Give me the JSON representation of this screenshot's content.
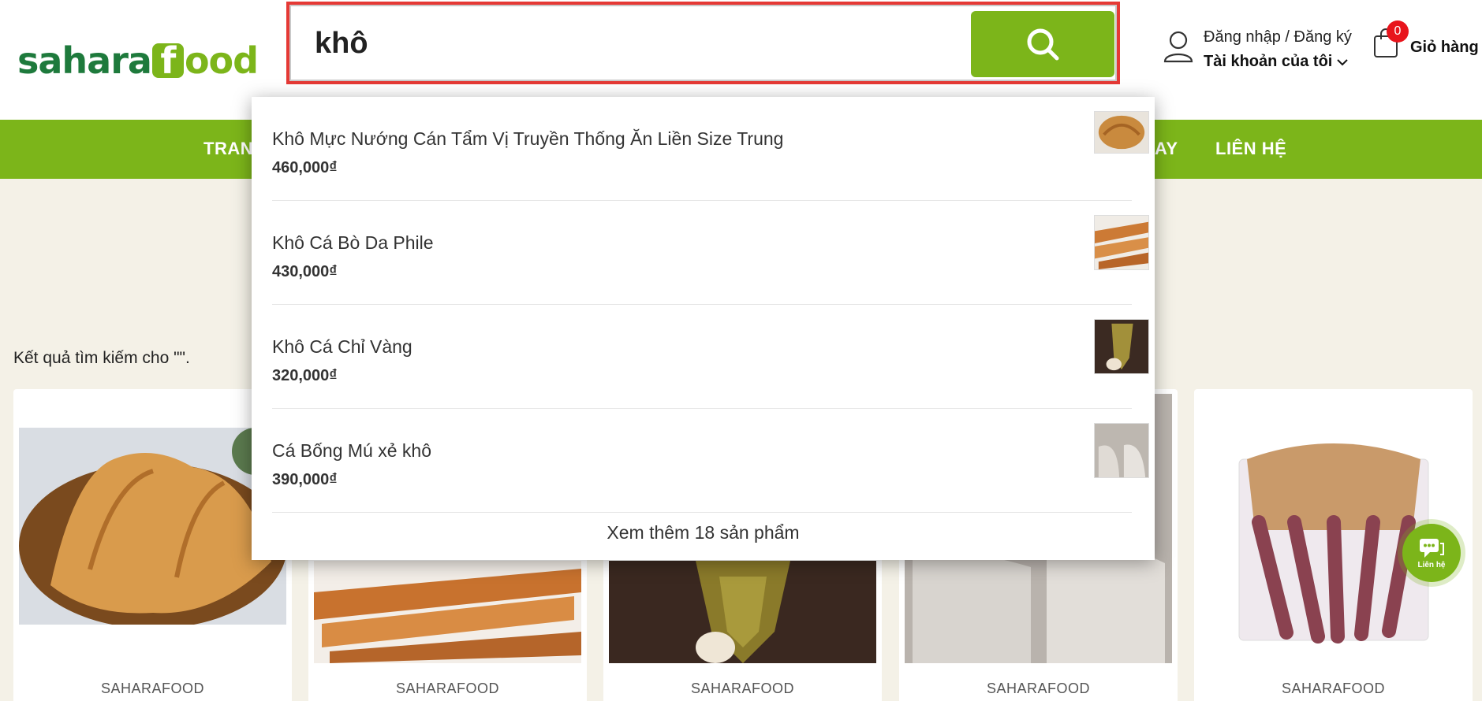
{
  "logo": {
    "part_a": "sahara",
    "part_f": "f",
    "part_b": "ood"
  },
  "search": {
    "value": "khô",
    "placeholder": ""
  },
  "account": {
    "line1": "Đăng nhập / Đăng ký",
    "line2": "Tài khoản của tôi"
  },
  "cart": {
    "count": "0",
    "label": "Giỏ hàng"
  },
  "nav": {
    "items": [
      "TRAN",
      "AY",
      "LIÊN HỆ"
    ]
  },
  "results": {
    "text": "Kết quả tìm kiếm cho \"\"."
  },
  "cards": [
    {
      "brand": "SAHARAFOOD"
    },
    {
      "brand": "SAHARAFOOD"
    },
    {
      "brand": "SAHARAFOOD"
    },
    {
      "brand": "SAHARAFOOD"
    },
    {
      "brand": "SAHARAFOOD"
    }
  ],
  "dropdown": {
    "items": [
      {
        "name": "Khô Mực Nướng Cán Tẩm Vị Truyền Thống Ăn Liền Size Trung",
        "price": "460,000₫"
      },
      {
        "name": "Khô Cá Bò Da Phile",
        "price": "430,000₫"
      },
      {
        "name": "Khô Cá Chỉ Vàng",
        "price": "320,000₫"
      },
      {
        "name": "Cá Bống Mú xẻ khô",
        "price": "390,000₫"
      }
    ],
    "more": "Xem thêm 18 sản phẩm"
  },
  "contact": {
    "label": "Liên hệ"
  },
  "colors": {
    "brand_green": "#7cb51a",
    "logo_dark_green": "#1e7a3c",
    "badge_red": "#e8141c",
    "focus_red": "#e53935"
  },
  "icons": [
    "search-icon",
    "user-icon",
    "chevron-down-icon",
    "shopping-bag-icon",
    "chat-icon"
  ]
}
